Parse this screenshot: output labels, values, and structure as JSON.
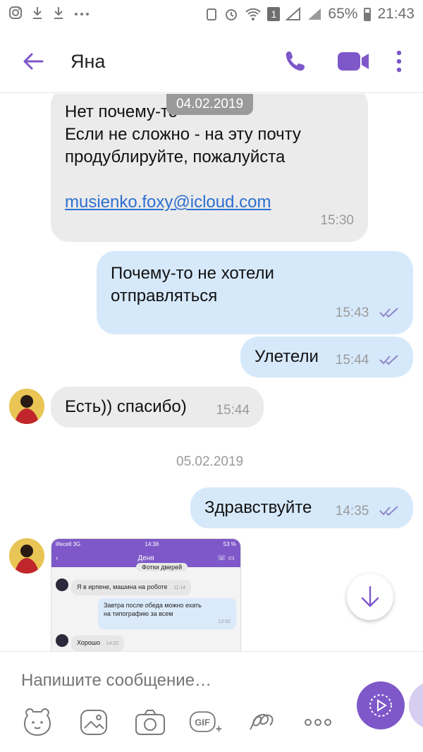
{
  "status_bar": {
    "battery_percent": "65%",
    "time": "21:43",
    "sim": "1"
  },
  "header": {
    "contact_name": "Яна"
  },
  "messages": [
    {
      "id": "m1",
      "direction": "in",
      "lines": [
        "Нет почему-то",
        "Если не сложно - на эту почту",
        "продублируйте, пожалуйста"
      ],
      "link": "musienko.foxy@icloud.com",
      "time": "15:30"
    },
    {
      "id": "m2",
      "direction": "out",
      "lines": [
        "Почему-то не хотели",
        "отправляться"
      ],
      "time": "15:43"
    },
    {
      "id": "m3",
      "direction": "out",
      "lines": [
        "Улетели"
      ],
      "time": "15:44"
    },
    {
      "id": "m4",
      "direction": "in",
      "lines": [
        "Есть)) спасибо)"
      ],
      "time": "15:44"
    },
    {
      "id": "m5",
      "direction": "out",
      "lines": [
        "Здравствуйте"
      ],
      "time": "14:35"
    }
  ],
  "date_separators": {
    "floating": "04.02.2019",
    "second": "05.02.2019"
  },
  "screenshot_preview": {
    "carrier": "lifecell 3G",
    "time": "14:36",
    "battery": "53 %",
    "contact": "Деня",
    "partial_top": "Фотки дверей",
    "msg1": "Я в ирпене, машина на роботе",
    "msg1_time": "11:14",
    "msg2_line1": "Завтра после обеда можно ехать",
    "msg2_line2": "на типографию за всем",
    "msg2_time": "12:02",
    "msg3": "Хорошо",
    "msg3_time": "14:22"
  },
  "composer": {
    "placeholder": "Напишите сообщение…"
  },
  "colors": {
    "accent": "#7e58c9",
    "incoming_bubble": "#ebebeb",
    "outgoing_bubble": "#d6e9fb",
    "link": "#2d6fd1"
  }
}
